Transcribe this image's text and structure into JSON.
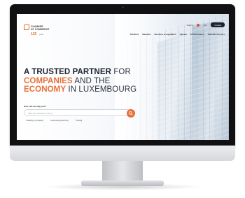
{
  "header": {
    "logo_line1": "CHAMBER",
    "logo_line2": "OF COMMERCE",
    "logo_anniversary": "125",
    "logo_years_label": "years",
    "top_links": [
      "Search",
      "EN"
    ],
    "contact_label": "Contact",
    "nav": [
      "Solutions",
      "Members",
      "Business & Legislation",
      "Agenda",
      "All Information",
      "Thematic dossiers"
    ]
  },
  "hero": {
    "line1_bold": "A TRUSTED PARTNER",
    "line1_light": "FOR",
    "line2_bold": "COMPANIES",
    "line2_light": "AND THE",
    "line3_bold": "ECONOMY",
    "line3_light": "IN LUXEMBOURG"
  },
  "search": {
    "label": "How can we help you?",
    "placeholder": "Start your business, training...",
    "quick_links": [
      "Creating my company",
      "Luxembourg economy",
      "Training"
    ]
  },
  "colors": {
    "accent": "#e8703a",
    "dark": "#1c2430"
  },
  "icons": {
    "search_button": "search-icon"
  }
}
